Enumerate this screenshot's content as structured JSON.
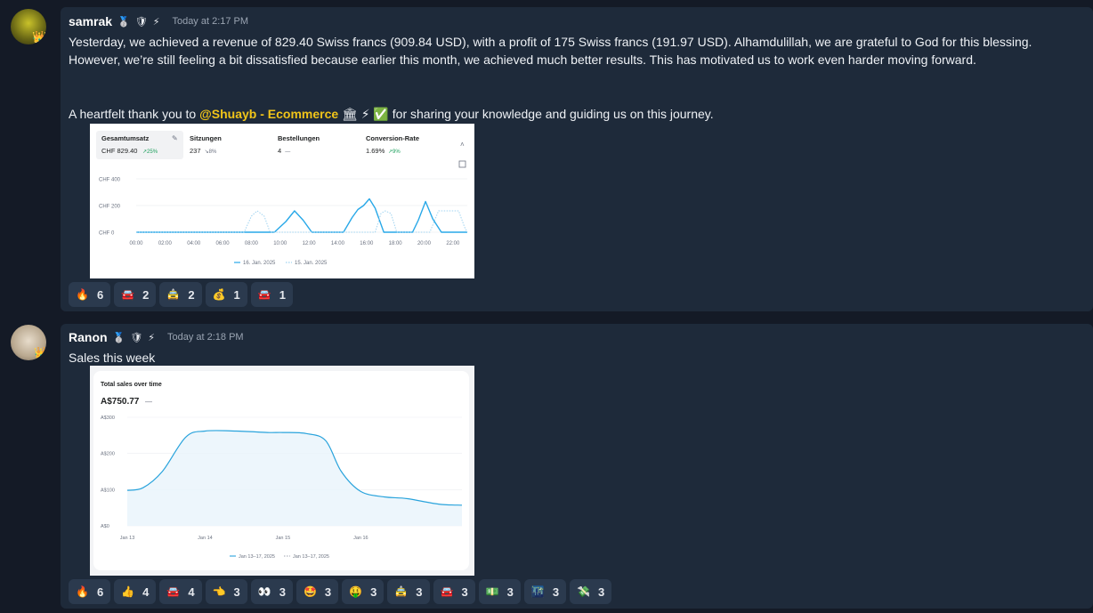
{
  "messages": [
    {
      "username": "samrak",
      "badges": [
        "🥈",
        "🛡",
        "⚡"
      ],
      "avatar_badge": "👑",
      "timestamp": "Today at 2:17 PM",
      "text_p1": "Yesterday, we achieved a revenue of 829.40 Swiss francs (909.84 USD), with a profit of 175 Swiss francs (191.97 USD). Alhamdulillah, we are grateful to God for this blessing. However, we’re still feeling a bit dissatisfied because earlier this month, we achieved much better results. This has motivated us to work even harder moving forward.",
      "text_p2_before": "A heartfelt thank you to ",
      "mention": "@Shuayb - Ecommerce",
      "mention_emoji": "🏛 ⚡ ✅",
      "text_p2_after": " for sharing your knowledge and guiding us on this journey.",
      "reactions": [
        {
          "icon": "fire-icon",
          "emoji": "🔥",
          "count": "6"
        },
        {
          "icon": "car-icon",
          "emoji": "🚘",
          "count": "2"
        },
        {
          "icon": "taxi-icon",
          "emoji": "🚖",
          "count": "2"
        },
        {
          "icon": "money-bag-icon",
          "emoji": "💰",
          "count": "1"
        },
        {
          "icon": "car-red-icon",
          "emoji": "🚘",
          "count": "1"
        }
      ]
    },
    {
      "username": "Ranon",
      "badges": [
        "🥈",
        "🛡",
        "⚡"
      ],
      "avatar_badge": "👑",
      "timestamp": "Today at 2:18 PM",
      "text": "Sales this week",
      "reactions": [
        {
          "icon": "fire-icon",
          "emoji": "🔥",
          "count": "6"
        },
        {
          "icon": "thumbs-up-icon",
          "emoji": "👍",
          "count": "4"
        },
        {
          "icon": "car-icon",
          "emoji": "🚘",
          "count": "4"
        },
        {
          "icon": "pointing-icon",
          "emoji": "👈",
          "count": "3"
        },
        {
          "icon": "eyes-icon",
          "emoji": "👀",
          "count": "3"
        },
        {
          "icon": "star-struck-icon",
          "emoji": "🤩",
          "count": "3"
        },
        {
          "icon": "money-mouth-icon",
          "emoji": "🤑",
          "count": "3"
        },
        {
          "icon": "taxi-icon",
          "emoji": "🚖",
          "count": "3"
        },
        {
          "icon": "car-blue-icon",
          "emoji": "🚘",
          "count": "3"
        },
        {
          "icon": "money-green-icon",
          "emoji": "💵",
          "count": "3"
        },
        {
          "icon": "city-icon",
          "emoji": "🌃",
          "count": "3"
        },
        {
          "icon": "flying-money-icon",
          "emoji": "💸",
          "count": "3"
        }
      ]
    }
  ],
  "chart_data": [
    {
      "type": "line",
      "kpis": [
        {
          "label": "Gesamtumsatz",
          "value": "CHF 829.40",
          "change": "↗25%",
          "change_color": "#1a9f5b"
        },
        {
          "label": "Sitzungen",
          "value": "237",
          "change": "↘8%",
          "change_color": "#6b7280"
        },
        {
          "label": "Bestellungen",
          "value": "4",
          "change": "—",
          "change_color": "#6b7280"
        },
        {
          "label": "Conversion-Rate",
          "value": "1.69%",
          "change": "↗9%",
          "change_color": "#1a9f5b"
        }
      ],
      "y_ticks": [
        "CHF 400",
        "CHF 200",
        "CHF 0"
      ],
      "ylim": [
        0,
        400
      ],
      "x_ticks": [
        "00:00",
        "02:00",
        "04:00",
        "06:00",
        "08:00",
        "10:00",
        "12:00",
        "14:00",
        "16:00",
        "18:00",
        "20:00",
        "22:00"
      ],
      "xlim": [
        0,
        23
      ],
      "series": [
        {
          "name": "16. Jan. 2025",
          "style": "solid",
          "color": "#28a8e8",
          "x": [
            0,
            9.6,
            10.4,
            11,
            11.6,
            12.2,
            14.4,
            15,
            15.4,
            15.8,
            16.2,
            16.6,
            17.2,
            19.2,
            19.6,
            20.1,
            20.6,
            21.2,
            23
          ],
          "y": [
            0,
            0,
            80,
            160,
            90,
            0,
            0,
            110,
            170,
            200,
            250,
            180,
            0,
            0,
            90,
            230,
            100,
            0,
            0
          ]
        },
        {
          "name": "15. Jan. 2025",
          "style": "dotted",
          "color": "#9fd3f0",
          "x": [
            0,
            7.5,
            8,
            8.4,
            8.9,
            9.3,
            16.6,
            17,
            17.3,
            17.7,
            18.1,
            20.4,
            21,
            22.4,
            22.8,
            23
          ],
          "y": [
            0,
            0,
            120,
            160,
            120,
            0,
            0,
            140,
            160,
            140,
            0,
            0,
            160,
            160,
            40,
            0
          ]
        }
      ],
      "legend": "bottom"
    },
    {
      "type": "area",
      "title": "Total sales over time",
      "headline": "A$750.77",
      "headline_suffix": "—",
      "y_ticks": [
        "A$300",
        "A$200",
        "A$100",
        "A$0"
      ],
      "ylim": [
        0,
        300
      ],
      "x_ticks": [
        "Jan 13",
        "Jan 14",
        "Jan 15",
        "Jan 16"
      ],
      "xlim": [
        0,
        4.3
      ],
      "series": [
        {
          "name": "Jan 13–17, 2025",
          "style": "solid",
          "color": "#29a3dc",
          "x": [
            0,
            0.2,
            0.45,
            0.75,
            1.0,
            1.4,
            1.8,
            2.0,
            2.3,
            2.55,
            2.75,
            3.0,
            3.3,
            3.6,
            4.0,
            4.3
          ],
          "y": [
            98,
            105,
            150,
            245,
            262,
            262,
            258,
            258,
            255,
            235,
            150,
            95,
            80,
            75,
            60,
            57
          ]
        },
        {
          "name": "Jan 13–17, 2025",
          "style": "dotted",
          "color": "#9ca3af",
          "x": [],
          "y": []
        }
      ],
      "legend": "bottom"
    }
  ]
}
